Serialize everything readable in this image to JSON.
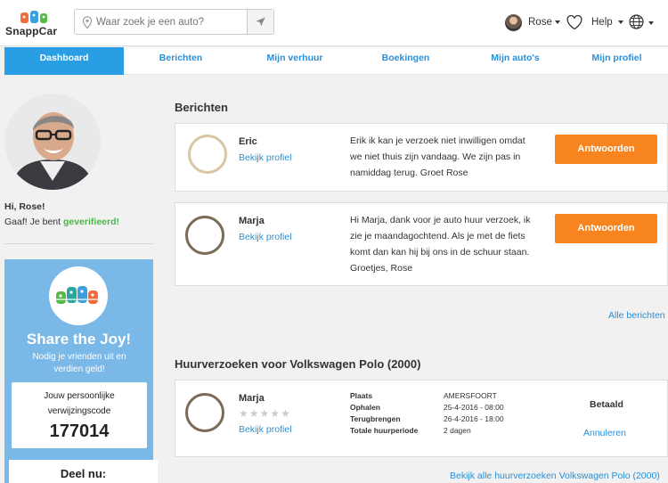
{
  "header": {
    "logo_text": "SnappCar",
    "search_placeholder": "Waar zoek je een auto?",
    "user_name": "Rose",
    "help_label": "Help"
  },
  "tabs": [
    {
      "label": "Dashboard",
      "active": true
    },
    {
      "label": "Berichten",
      "active": false
    },
    {
      "label": "Mijn verhuur",
      "active": false
    },
    {
      "label": "Boekingen",
      "active": false
    },
    {
      "label": "Mijn auto's",
      "active": false
    },
    {
      "label": "Mijn profiel",
      "active": false
    }
  ],
  "profile": {
    "greeting": "Hi, Rose!",
    "verified_prefix": "Gaaf! Je bent ",
    "verified_word": "geverifieerd!"
  },
  "share": {
    "title": "Share the Joy!",
    "subtitle": "Nodig je vrienden uit en verdien geld!",
    "code_label": "Jouw persoonlijke verwijzingscode",
    "code": "177014",
    "share_now": "Deel nu:"
  },
  "messages": {
    "title": "Berichten",
    "profile_link": "Bekijk profiel",
    "reply_label": "Antwoorden",
    "all_link": "Alle berichten",
    "items": [
      {
        "name": "Eric",
        "text": "Erik ik kan je verzoek niet inwilligen omdat we niet thuis zijn vandaag. We zijn pas in namiddag terug. Groet Rose"
      },
      {
        "name": "Marja",
        "text": "Hi Marja, dank voor je auto huur verzoek, ik zie je maandagochtend. Als je met de fiets komt dan kan hij bij ons in de schuur staan. Groetjes, Rose"
      }
    ]
  },
  "requests": {
    "title": "Huurverzoeken voor Volkswagen Polo (2000)",
    "item": {
      "name": "Marja",
      "profile_link": "Bekijk profiel",
      "rating": 0,
      "rating_max": 5,
      "fields": [
        {
          "label": "Plaats",
          "value": "AMERSFOORT"
        },
        {
          "label": "Ophalen",
          "value": "25-4-2016 - 08:00"
        },
        {
          "label": "Terugbrengen",
          "value": "26-4-2016 - 18:00"
        },
        {
          "label": "Totale huurperiode",
          "value": "2 dagen"
        }
      ],
      "status": "Betaald",
      "cancel_label": "Annuleren"
    },
    "all_link": "Bekijk alle huurverzoeken Volkswagen Polo (2000)"
  },
  "colors": {
    "accent_blue": "#2a9ee4",
    "link_blue": "#2b8fd6",
    "orange": "#f7841f",
    "verified_green": "#49b649",
    "share_bg": "#7ab8e8"
  }
}
